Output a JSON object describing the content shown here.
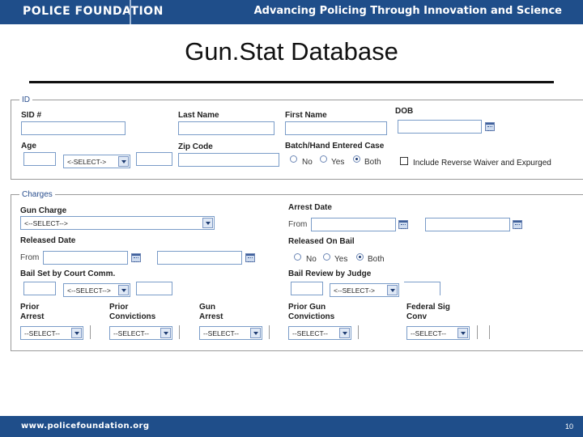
{
  "header": {
    "brand": "POLICE FOUNDATION",
    "tagline": "Advancing Policing Through Innovation and Science"
  },
  "title": "Gun.Stat Database",
  "id_section": {
    "legend": "ID",
    "sid_label": "SID #",
    "last_name_label": "Last Name",
    "first_name_label": "First Name",
    "dob_label": "DOB",
    "age_label": "Age",
    "age_select": "<-SELECT->",
    "zip_label": "Zip Code",
    "batch_label": "Batch/Hand Entered Case",
    "radio_no": "No",
    "radio_yes": "Yes",
    "radio_both": "Both",
    "reverse_waiver_label": "Include Reverse Waiver and Expurged"
  },
  "charges_section": {
    "legend": "Charges",
    "gun_charge_label": "Gun Charge",
    "gun_charge_select": "<--SELECT-->",
    "arrest_date_label": "Arrest Date",
    "from_label": "From",
    "released_date_label": "Released Date",
    "released_on_bail_label": "Released On Bail",
    "radio_no": "No",
    "radio_yes": "Yes",
    "radio_both": "Both",
    "bail_court_label": "Bail Set by Court Comm.",
    "bail_court_select": "<--SELECT-->",
    "bail_judge_label": "Bail Review by Judge",
    "bail_judge_select": "<--SELECT->",
    "prior_arrest_label1": "Prior",
    "prior_arrest_label2": "Arrest",
    "prior_convictions_label1": "Prior",
    "prior_convictions_label2": "Convictions",
    "gun_arrest_label1": "Gun",
    "gun_arrest_label2": "Arrest",
    "prior_gun_convictions_label1": "Prior Gun",
    "prior_gun_convictions_label2": "Convictions",
    "federal_sig_label1": "Federal Sig",
    "federal_sig_label2": "Conv",
    "select_dashes": "--SELECT--"
  },
  "footer": {
    "url": "www.policefoundation.org",
    "page": "10"
  }
}
